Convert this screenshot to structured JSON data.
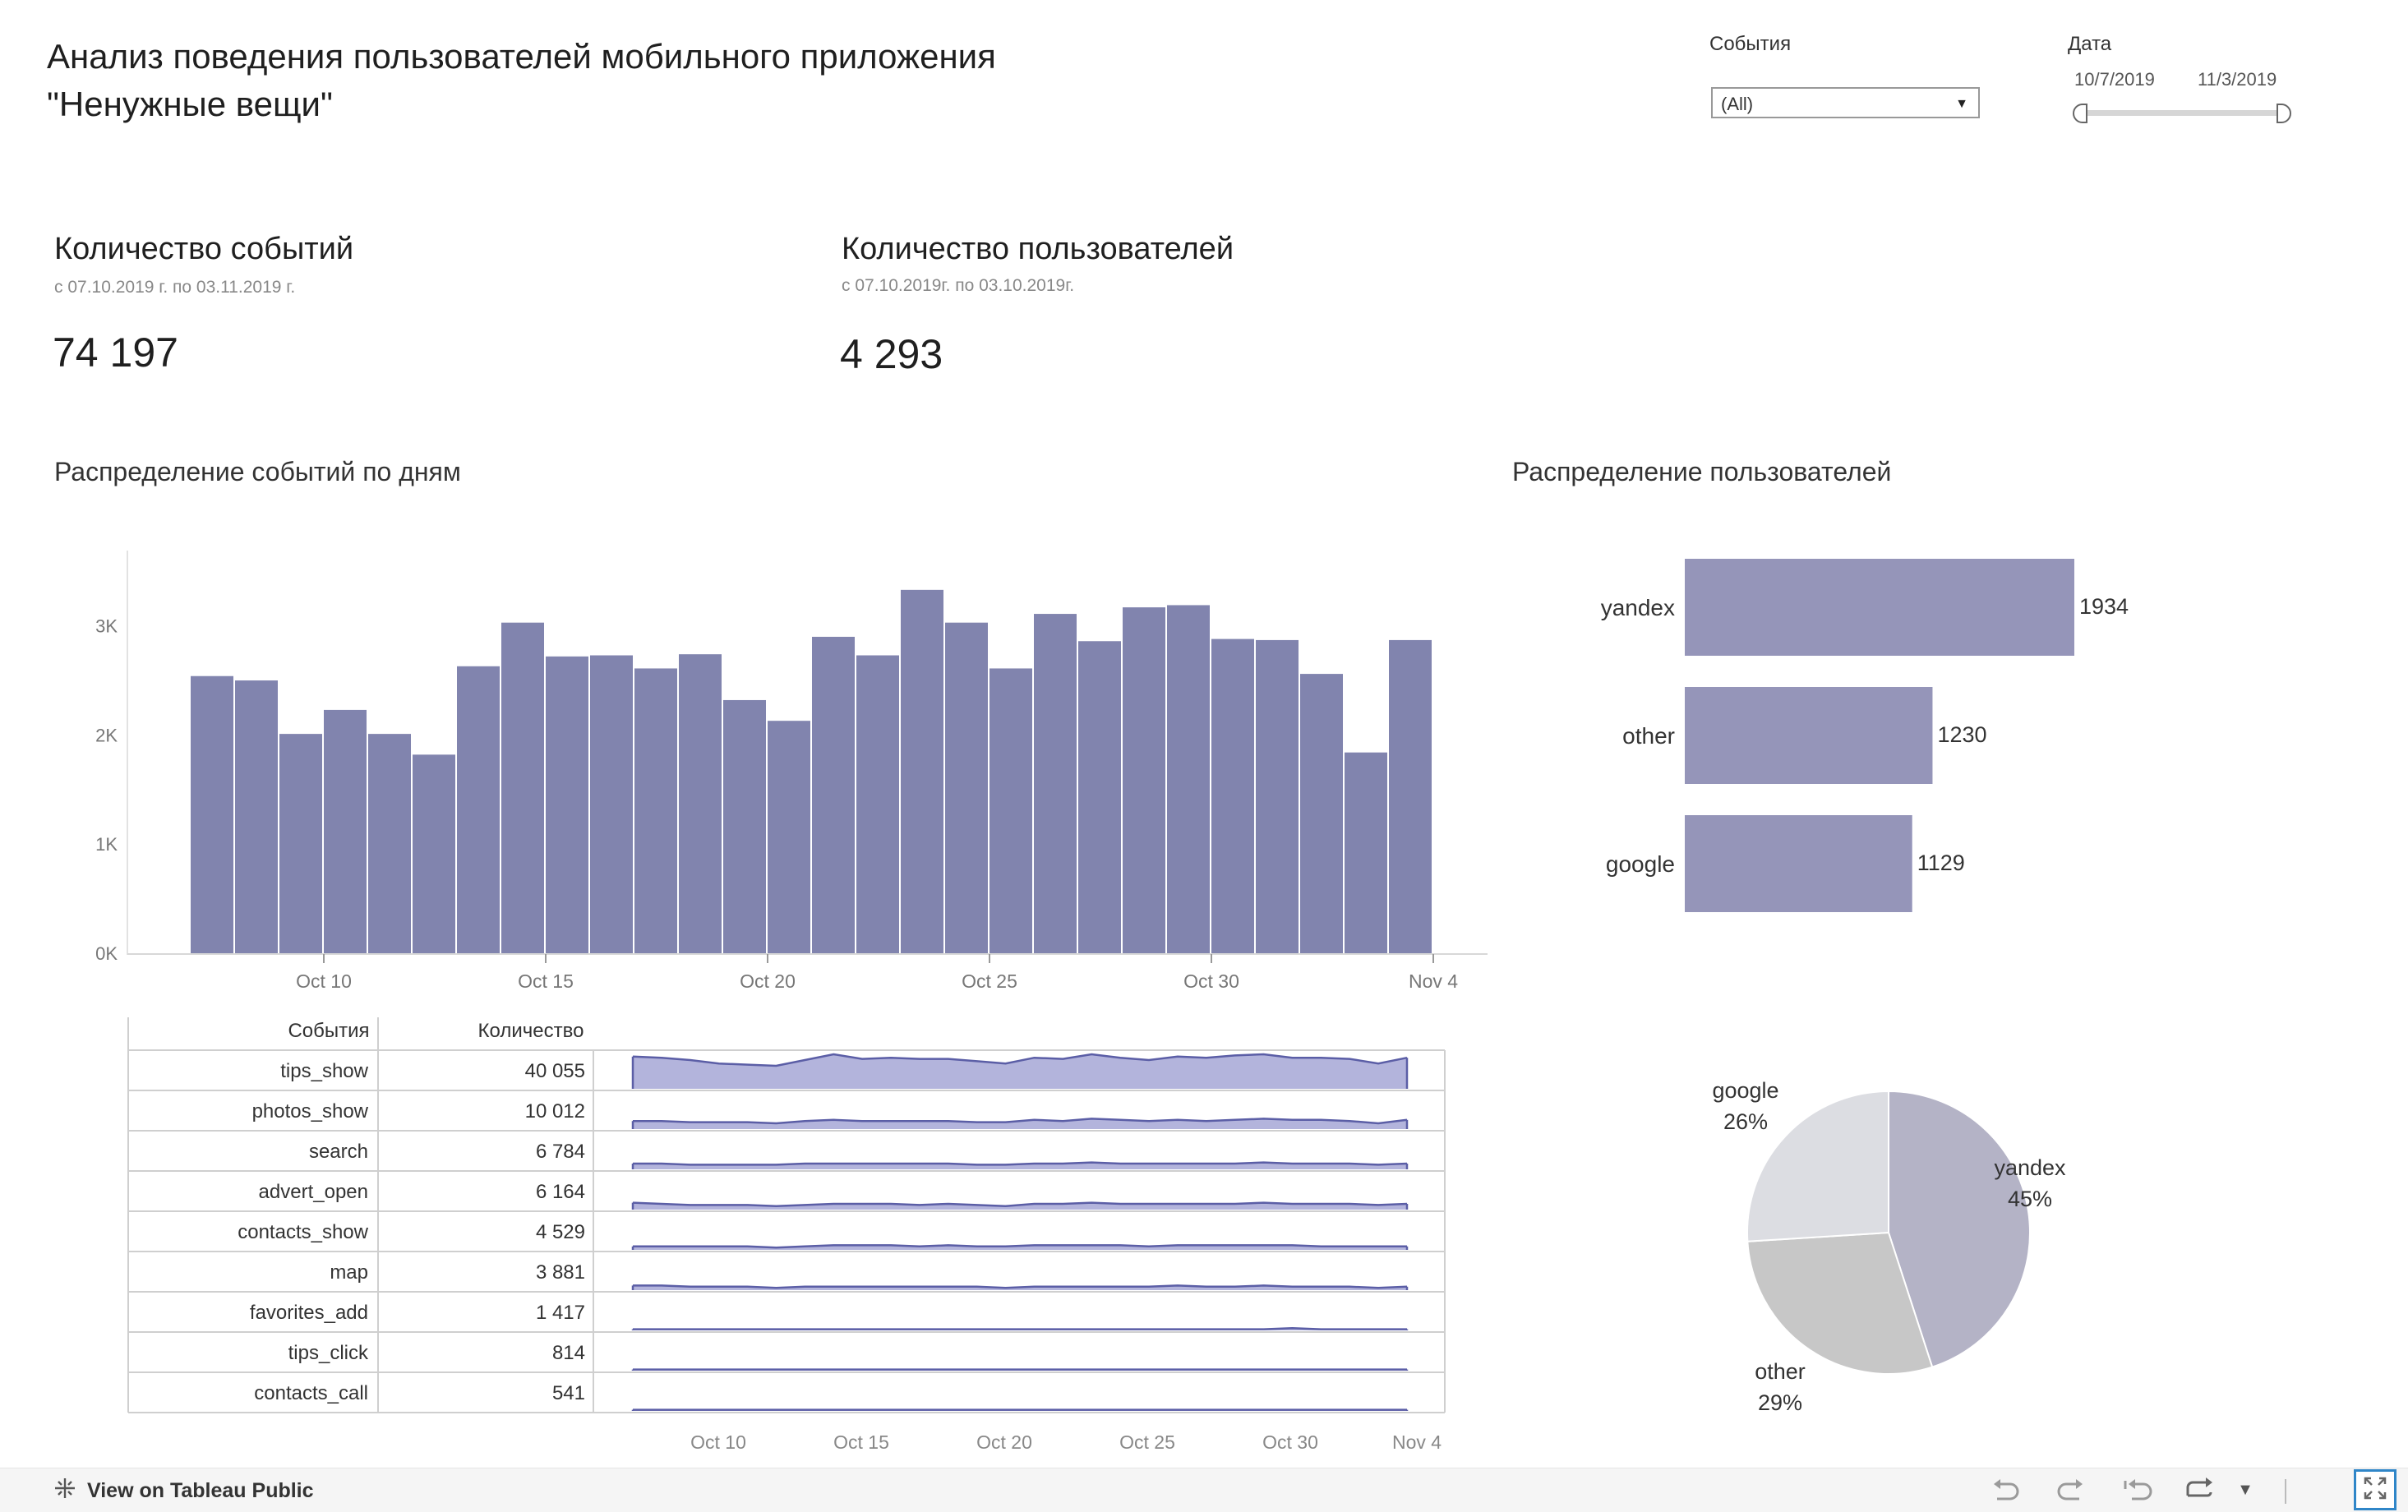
{
  "header": {
    "title": "Анализ поведения пользователей мобильного приложения \"Ненужные вещи\""
  },
  "filters": {
    "events_label": "События",
    "events_value": "(All)",
    "date_label": "Дата",
    "date_start": "10/7/2019",
    "date_end": "11/3/2019"
  },
  "kpis": {
    "events": {
      "title": "Количество событий",
      "subtitle": "с 07.10.2019 г.  по 03.11.2019 г.",
      "value": "74 197"
    },
    "users": {
      "title": "Количество пользователей",
      "subtitle": "с 07.10.2019г. по 03.10.2019г.",
      "value": "4 293"
    }
  },
  "sections": {
    "daily_title": "Распределение событий по дням",
    "users_title": "Распределение пользователей"
  },
  "colors": {
    "bar": "#8184ae",
    "bar_users": "#9595b9",
    "spark_fill": "#b3b4dc",
    "spark_line": "#5b5ea6",
    "accent": "#2f86c8"
  },
  "chart_data": [
    {
      "type": "bar",
      "name": "daily_events",
      "x": [
        "2019-10-07",
        "2019-10-08",
        "2019-10-09",
        "2019-10-10",
        "2019-10-11",
        "2019-10-12",
        "2019-10-13",
        "2019-10-14",
        "2019-10-15",
        "2019-10-16",
        "2019-10-17",
        "2019-10-18",
        "2019-10-19",
        "2019-10-20",
        "2019-10-21",
        "2019-10-22",
        "2019-10-23",
        "2019-10-24",
        "2019-10-25",
        "2019-10-26",
        "2019-10-27",
        "2019-10-28",
        "2019-10-29",
        "2019-10-30",
        "2019-10-31",
        "2019-11-01",
        "2019-11-02",
        "2019-11-03"
      ],
      "values": [
        2540,
        2500,
        2010,
        2230,
        2010,
        1820,
        2630,
        3030,
        2720,
        2730,
        2610,
        2740,
        2320,
        2130,
        2900,
        2730,
        3330,
        3030,
        2610,
        3110,
        2860,
        3170,
        3190,
        2880,
        2870,
        2560,
        1840,
        2870
      ],
      "yticks": [
        "0K",
        "1K",
        "2K",
        "3K"
      ],
      "ylim": [
        0,
        3600
      ],
      "xticks": [
        "Oct 10",
        "Oct 15",
        "Oct 20",
        "Oct 25",
        "Oct 30",
        "Nov 4"
      ]
    },
    {
      "type": "bar",
      "name": "users_by_source",
      "orientation": "horizontal",
      "categories": [
        "yandex",
        "other",
        "google"
      ],
      "values": [
        1934,
        1230,
        1129
      ]
    },
    {
      "type": "pie",
      "name": "users_share",
      "categories": [
        "yandex",
        "other",
        "google"
      ],
      "values": [
        45,
        29,
        26
      ],
      "labels": [
        "45%",
        "29%",
        "26%"
      ],
      "colors": [
        "#b4b3c6",
        "#c7c7c7",
        "#dcdde2"
      ]
    },
    {
      "type": "table",
      "name": "events_table",
      "columns": [
        "События",
        "Количество"
      ],
      "rows": [
        {
          "event": "tips_show",
          "count": "40 055",
          "spark": [
            28,
            27,
            25,
            22,
            21,
            20,
            25,
            30,
            26,
            27,
            26,
            26,
            24,
            22,
            27,
            26,
            30,
            27,
            25,
            28,
            27,
            29,
            30,
            27,
            27,
            26,
            22,
            27
          ]
        },
        {
          "event": "photos_show",
          "count": "10 012",
          "spark": [
            7,
            7,
            6,
            6,
            6,
            5,
            7,
            8,
            7,
            7,
            7,
            7,
            6,
            6,
            8,
            7,
            9,
            8,
            7,
            8,
            7,
            8,
            9,
            8,
            8,
            7,
            5,
            8
          ]
        },
        {
          "event": "search",
          "count": "6 784",
          "spark": [
            5,
            5,
            4,
            4,
            4,
            4,
            5,
            5,
            5,
            5,
            5,
            5,
            4,
            4,
            5,
            5,
            6,
            5,
            5,
            5,
            5,
            5,
            6,
            5,
            5,
            5,
            4,
            5
          ]
        },
        {
          "event": "advert_open",
          "count": "6 164",
          "spark": [
            6,
            5,
            4,
            4,
            4,
            3,
            4,
            5,
            5,
            5,
            4,
            5,
            4,
            3,
            5,
            5,
            6,
            5,
            5,
            5,
            5,
            5,
            6,
            5,
            5,
            5,
            4,
            5
          ]
        },
        {
          "event": "contacts_show",
          "count": "4 529",
          "spark": [
            3,
            3,
            3,
            3,
            3,
            2,
            3,
            4,
            4,
            4,
            3,
            4,
            3,
            3,
            4,
            4,
            4,
            4,
            3,
            4,
            4,
            4,
            4,
            4,
            3,
            3,
            3,
            3
          ]
        },
        {
          "event": "map",
          "count": "3 881",
          "spark": [
            4,
            4,
            3,
            3,
            3,
            2,
            3,
            3,
            3,
            3,
            3,
            3,
            3,
            2,
            3,
            3,
            3,
            3,
            3,
            4,
            3,
            3,
            4,
            3,
            3,
            3,
            2,
            3
          ]
        },
        {
          "event": "favorites_add",
          "count": "1 417",
          "spark": [
            1,
            1,
            1,
            1,
            1,
            1,
            1,
            1,
            1,
            1,
            1,
            1,
            1,
            1,
            1,
            1,
            1,
            1,
            1,
            1,
            1,
            1,
            1,
            2,
            1,
            1,
            1,
            1
          ]
        },
        {
          "event": "tips_click",
          "count": "814",
          "spark": [
            1,
            1,
            1,
            1,
            1,
            1,
            1,
            1,
            1,
            1,
            1,
            1,
            1,
            1,
            1,
            1,
            1,
            1,
            1,
            1,
            1,
            1,
            1,
            1,
            1,
            1,
            1,
            1
          ]
        },
        {
          "event": "contacts_call",
          "count": "541",
          "spark": [
            1,
            1,
            1,
            1,
            1,
            1,
            1,
            1,
            1,
            1,
            1,
            1,
            1,
            1,
            1,
            1,
            1,
            1,
            1,
            1,
            1,
            1,
            1,
            1,
            1,
            1,
            1,
            1
          ]
        }
      ],
      "xticks": [
        "Oct 10",
        "Oct 15",
        "Oct 20",
        "Oct 25",
        "Oct 30",
        "Nov 4"
      ]
    }
  ],
  "footer": {
    "view_label": "View on Tableau Public",
    "icons": [
      "undo-icon",
      "redo-icon",
      "revert-icon",
      "share-icon",
      "dropdown-icon",
      "fullscreen-icon"
    ]
  }
}
